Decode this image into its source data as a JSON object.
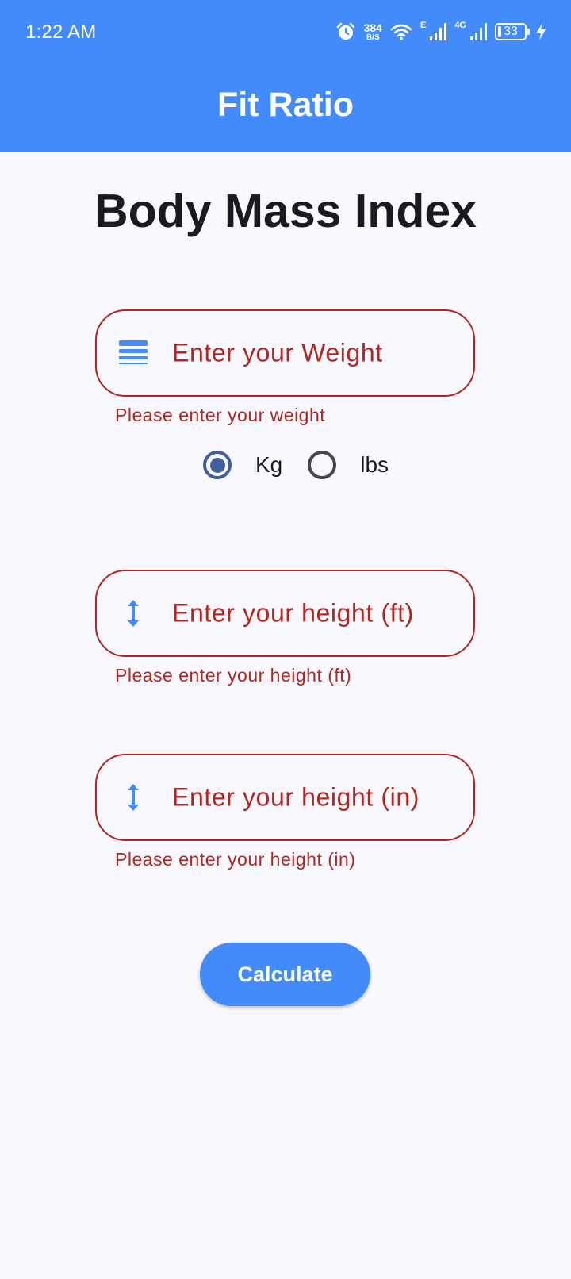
{
  "status_bar": {
    "time": "1:22 AM",
    "net_speed_value": "384",
    "net_speed_unit": "B/S",
    "network_label_1": "E",
    "network_label_2": "4G",
    "battery": "33",
    "icons": [
      "alarm-icon",
      "wifi-icon",
      "signal-icon",
      "signal-icon",
      "battery-icon",
      "charging-icon"
    ]
  },
  "app_bar": {
    "title": "Fit Ratio"
  },
  "main": {
    "title": "Body Mass Index",
    "weight_field": {
      "placeholder": "Enter your Weight",
      "error": "Please enter your weight",
      "icon": "weight-lines-icon"
    },
    "unit_options": [
      {
        "label": "Kg",
        "selected": true
      },
      {
        "label": "lbs",
        "selected": false
      }
    ],
    "height_ft_field": {
      "placeholder": "Enter your height (ft)",
      "error": "Please enter your height (ft)",
      "icon": "vertical-arrow-icon"
    },
    "height_in_field": {
      "placeholder": "Enter your height (in)",
      "error": "Please enter your height (in)",
      "icon": "vertical-arrow-icon"
    },
    "calculate_button": "Calculate"
  },
  "colors": {
    "primary": "#438AFB",
    "error": "#B3261E",
    "radio": "#3F5F9E",
    "background": "#F9F8FE"
  }
}
